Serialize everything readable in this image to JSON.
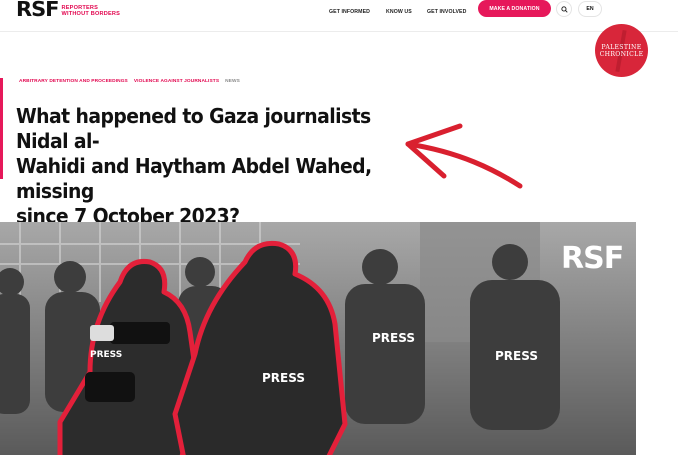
{
  "header": {
    "logo_mark": "RSF",
    "logo_line1": "REPORTERS",
    "logo_line2": "WITHOUT BORDERS",
    "nav": [
      "GET INFORMED",
      "KNOW US",
      "GET INVOLVED"
    ],
    "donate_label": "MAKE A DONATION",
    "language": "EN",
    "icons": {
      "search": "search-icon"
    }
  },
  "watermark": {
    "line1": "PALESTINE",
    "line2": "CHRONICLE"
  },
  "article": {
    "tags": [
      "ARBITRARY DETENTION AND PROCEEDINGS",
      "VIOLENCE AGAINST JOURNALISTS",
      "NEWS"
    ],
    "title_line1": "What happened to Gaza journalists Nidal al-",
    "title_line2": "Wahidi and Haytham Abdel Wahed, missing",
    "title_line3": "since 7 October 2023?"
  },
  "hero": {
    "overlay_mark": "RSF",
    "vest_labels": [
      "PRESS",
      "PRESS",
      "PRESS",
      "PRESS"
    ]
  },
  "colors": {
    "accent": "#e6185a",
    "tag": "#e2064f",
    "badge": "#d8263a",
    "arrow": "#d9202f"
  }
}
